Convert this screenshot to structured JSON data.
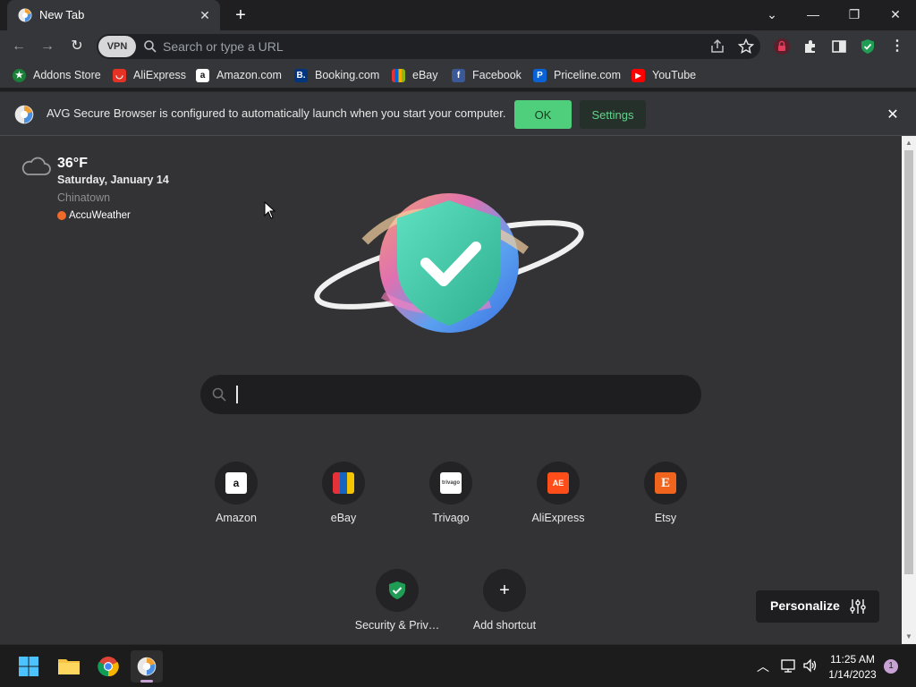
{
  "tab": {
    "title": "New Tab"
  },
  "omnibox": {
    "vpn_label": "VPN",
    "placeholder": "Search or type a URL"
  },
  "bookmarks": [
    {
      "label": "Addons Store",
      "color": "#1a7f37",
      "glyph": "★"
    },
    {
      "label": "AliExpress",
      "color": "#e43225",
      "glyph": "A"
    },
    {
      "label": "Amazon.com",
      "color": "#ffffff",
      "glyph": "a"
    },
    {
      "label": "Booking.com",
      "color": "#003580",
      "glyph": "B."
    },
    {
      "label": "eBay",
      "color": "#e53238",
      "glyph": "e"
    },
    {
      "label": "Facebook",
      "color": "#3b5998",
      "glyph": "f"
    },
    {
      "label": "Priceline.com",
      "color": "#0a63d6",
      "glyph": "P"
    },
    {
      "label": "YouTube",
      "color": "#ff0000",
      "glyph": "▶"
    }
  ],
  "infobar": {
    "message": "AVG Secure Browser is configured to automatically launch when you start your computer.",
    "ok_label": "OK",
    "settings_label": "Settings"
  },
  "weather": {
    "temperature": "36°F",
    "date": "Saturday, January 14",
    "location": "Chinatown",
    "source": "AccuWeather"
  },
  "shortcuts": [
    {
      "label": "Amazon",
      "glyph": "a",
      "bg": "#ffffff",
      "fg": "#111111"
    },
    {
      "label": "eBay",
      "glyph": "",
      "bg": "#ffd34e",
      "fg": "#1565c0"
    },
    {
      "label": "Trivago",
      "glyph": "trivago",
      "bg": "#ffffff",
      "fg": "#333333"
    },
    {
      "label": "AliExpress",
      "glyph": "AE",
      "bg": "#ff4e1a",
      "fg": "#ffffff"
    },
    {
      "label": "Etsy",
      "glyph": "E",
      "bg": "#f1641e",
      "fg": "#ffffff"
    }
  ],
  "shortcuts_row2": [
    {
      "label": "Security & Priv…"
    },
    {
      "label": "Add shortcut"
    }
  ],
  "personalize": {
    "label": "Personalize"
  },
  "taskbar": {
    "time": "11:25 AM",
    "date": "1/14/2023",
    "notifications": "1"
  },
  "colors": {
    "accent_green": "#4fcf7b",
    "content_bg": "#333336",
    "toolbar_bg": "#35363a"
  }
}
